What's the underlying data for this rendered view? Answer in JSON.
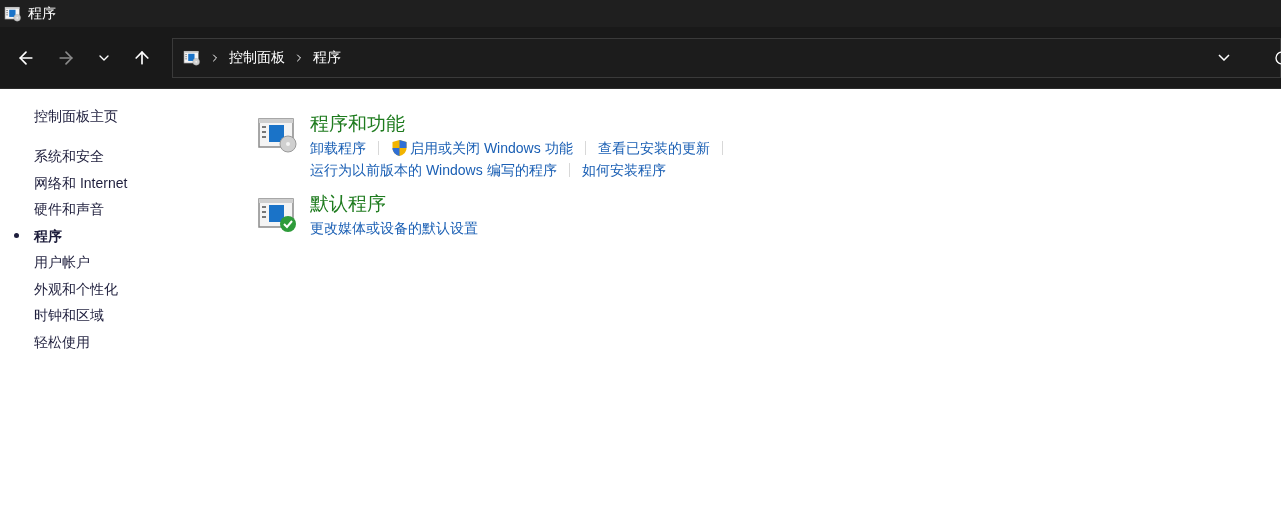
{
  "window": {
    "title": "程序"
  },
  "breadcrumb": [
    "控制面板",
    "程序"
  ],
  "sidebar": {
    "home": "控制面板主页",
    "items": [
      {
        "label": "系统和安全",
        "selected": false
      },
      {
        "label": "网络和 Internet",
        "selected": false
      },
      {
        "label": "硬件和声音",
        "selected": false
      },
      {
        "label": "程序",
        "selected": true
      },
      {
        "label": "用户帐户",
        "selected": false
      },
      {
        "label": "外观和个性化",
        "selected": false
      },
      {
        "label": "时钟和区域",
        "selected": false
      },
      {
        "label": "轻松使用",
        "selected": false
      }
    ]
  },
  "sections": [
    {
      "title": "程序和功能",
      "kind": "disc",
      "lines": [
        {
          "links": [
            {
              "label": "卸载程序",
              "kind": "plain",
              "separator_after": true
            },
            {
              "label": "启用或关闭 Windows 功能",
              "kind": "shield",
              "separator_after": true
            },
            {
              "label": "查看已安装的更新",
              "kind": "plain",
              "separator_after": true
            }
          ]
        },
        {
          "links": [
            {
              "label": "运行为以前版本的 Windows 编写的程序",
              "kind": "plain",
              "separator_after": true
            },
            {
              "label": "如何安装程序",
              "kind": "plain",
              "separator_after": false
            }
          ]
        }
      ]
    },
    {
      "title": "默认程序",
      "kind": "check",
      "lines": [
        {
          "links": [
            {
              "label": "更改媒体或设备的默认设置",
              "kind": "plain",
              "separator_after": false
            }
          ]
        }
      ]
    }
  ]
}
